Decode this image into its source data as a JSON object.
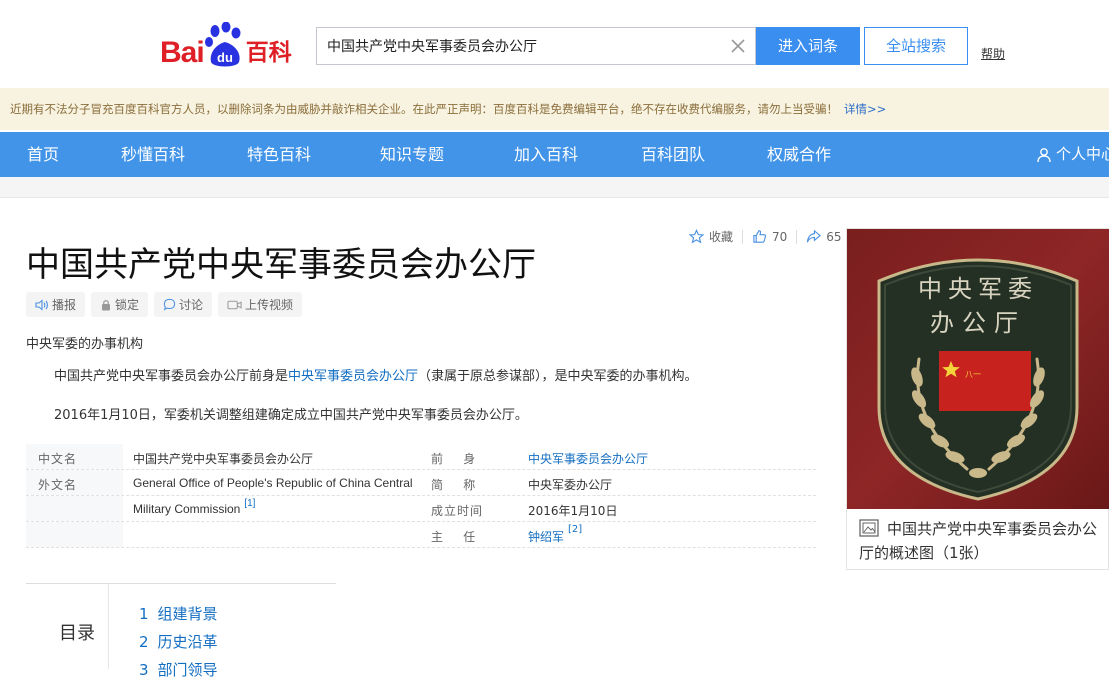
{
  "header": {
    "logo_bai": "Bai",
    "logo_du": "du",
    "logo_baike": "百科",
    "search_value": "中国共产党中央军事委员会办公厅",
    "enter_label": "进入词条",
    "site_search_label": "全站搜索",
    "help_label": "帮助"
  },
  "notice": {
    "text": "近期有不法分子冒充百度百科官方人员，以删除词条为由威胁并敲诈相关企业。在此严正声明：百度百科是免费编辑平台，绝不存在收费代编服务，请勿上当受骗！",
    "link": "详情>>"
  },
  "nav": {
    "items": [
      "首页",
      "秒懂百科",
      "特色百科",
      "知识专题",
      "加入百科",
      "百科团队",
      "权威合作"
    ],
    "user": "个人中心"
  },
  "title": "中国共产党中央军事委员会办公厅",
  "actions": {
    "collect": "收藏",
    "likes": "70",
    "shares": "65"
  },
  "tools": [
    "播报",
    "锁定",
    "讨论",
    "上传视频"
  ],
  "subtitle": "中央军委的办事机构",
  "summary": {
    "p1_a": "中国共产党中央军事委员会办公厅前身是",
    "p1_link": "中央军事委员会办公厅",
    "p1_b": "（隶属于原总参谋部），是中央军委的办事机构。",
    "p2": "2016年1月10日，军委机关调整组建确定成立中国共产党中央军事委员会办公厅。"
  },
  "basic_info": {
    "left": [
      {
        "key": "中文名",
        "value": "中国共产党中央军事委员会办公厅"
      },
      {
        "key": "外文名",
        "value_line1": "General Office of People's Republic of China Central",
        "value_line2": "Military Commission",
        "ref": "[1]"
      }
    ],
    "right": [
      {
        "key": "前    身",
        "value": "中央军事委员会办公厅"
      },
      {
        "key": "简    称",
        "value": "中央军委办公厅"
      },
      {
        "key": "成立时间",
        "value": "2016年1月10日"
      },
      {
        "key": "主    任",
        "value": "钟绍军",
        "ref": "[2]"
      }
    ]
  },
  "album": {
    "badge_line1": "中央军委",
    "badge_line2": "办公厅",
    "caption": "中国共产党中央军事委员会办公厅的概述图（1张）"
  },
  "catalog": {
    "title": "目录",
    "items": [
      {
        "num": "1",
        "label": "组建背景"
      },
      {
        "num": "2",
        "label": "历史沿革"
      },
      {
        "num": "3",
        "label": "部门领导"
      }
    ]
  },
  "colors": {
    "nav": "#4294e8",
    "brand_red": "#de1f26",
    "link": "#136ec2",
    "notice_bg": "#f8f3e0"
  }
}
